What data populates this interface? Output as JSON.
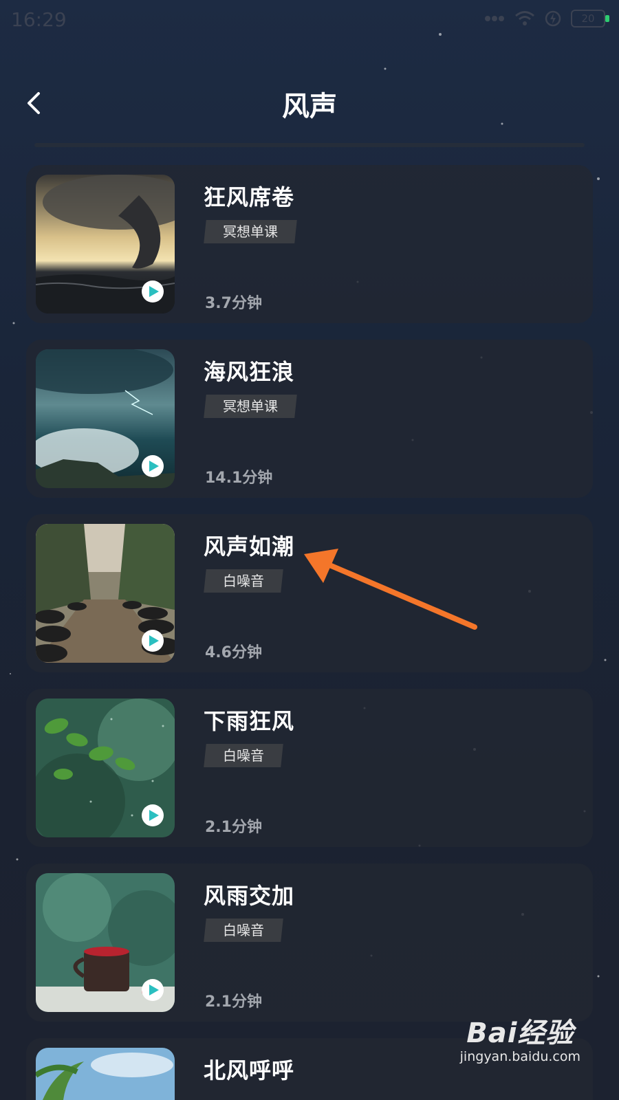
{
  "status_bar": {
    "time": "16:29",
    "battery": "20"
  },
  "header": {
    "title": "风声"
  },
  "items": [
    {
      "title": "狂风席卷",
      "tag": "冥想单课",
      "duration": "3.7分钟",
      "thumb": "tornado-over-sea"
    },
    {
      "title": "海风狂浪",
      "tag": "冥想单课",
      "duration": "14.1分钟",
      "thumb": "stormy-waves"
    },
    {
      "title": "风声如潮",
      "tag": "白噪音",
      "duration": "4.6分钟",
      "thumb": "jungle-tire-path"
    },
    {
      "title": "下雨狂风",
      "tag": "白噪音",
      "duration": "2.1分钟",
      "thumb": "rain-on-leaves"
    },
    {
      "title": "风雨交加",
      "tag": "白噪音",
      "duration": "2.1分钟",
      "thumb": "rainy-window-cup"
    },
    {
      "title": "北风呼呼",
      "thumb": "palm-sky"
    }
  ],
  "watermark": {
    "logo": "Bai经验",
    "site": "jingyan.baidu.com"
  },
  "colors": {
    "accent_play": "#2bbfc0",
    "annotation_arrow": "#f4762a",
    "card_bg": "#222732"
  }
}
